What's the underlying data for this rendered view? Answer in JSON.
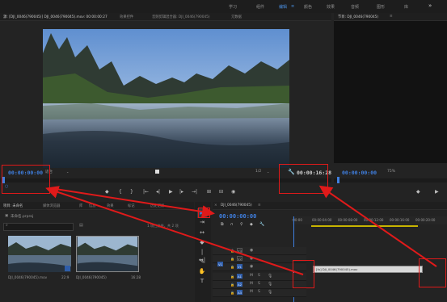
{
  "workspaces": [
    "学习",
    "组件",
    "编辑",
    "颜色",
    "效果",
    "音频",
    "图形",
    "库"
  ],
  "active_workspace_index": 2,
  "more_glyph": "»",
  "source_panel": {
    "tabs": [
      "源: [DJI_0046(790045)] DJI_0046(790045).mov: 00:00:00:27",
      "效果控件",
      "音频剪辑混合器: DJI_0046(790045)",
      "元数据"
    ],
    "timecode_left": "00:00:00:00",
    "fit_label": "适合",
    "ratio": "1/2",
    "timecode_right": "00:00:16:28",
    "marker_glyph": "◆"
  },
  "program_panel": {
    "tab": "节目: DJI_0046(790045)",
    "timecode": "00:00:00:00",
    "zoom": "75%"
  },
  "transport": [
    "◆",
    "{",
    "}",
    "|←",
    "◂|",
    "▶",
    "|▸",
    "→|",
    "⊞",
    "⊟",
    "◉"
  ],
  "project_panel": {
    "tabs": [
      "项目: 未命名",
      "媒体浏览器",
      "库",
      "信息",
      "效果",
      "标记",
      "历史记录"
    ],
    "file_name": "未命名.prproj",
    "selection_info": "1 项已选择，共 2 项",
    "clips": [
      {
        "name": "DJI_0046(790045).mov",
        "duration": "22:9"
      },
      {
        "name": "DJI_0046(790045)",
        "duration": "16:28"
      }
    ]
  },
  "tools": [
    "▶",
    "⇥",
    "↔",
    "◆",
    "|↔|",
    "✎",
    "✋",
    "T"
  ],
  "timeline": {
    "tab": "DJI_0046(790045)",
    "timecode": "00:00:00:00",
    "ruler": [
      ":00:00",
      "00:00:04:00",
      "00:00:08:00",
      "00:00:12:00",
      "00:00:16:00",
      "00:00:20:00"
    ],
    "video_tracks": [
      "V3",
      "V2",
      "V1"
    ],
    "audio_tracks": [
      "A1",
      "A2",
      "A3"
    ],
    "clip_label": "[fx] DJI_0046(790045).mov",
    "track_buttons": {
      "sync": "V1",
      "mute": "M",
      "solo": "S",
      "eye": "◉",
      "lock": "🔒"
    }
  },
  "colors": {
    "accent": "#3f7fe0",
    "annotation": "#e01a1a",
    "clip": "#d8d8d8",
    "timeline_bar": "#c8b400"
  }
}
